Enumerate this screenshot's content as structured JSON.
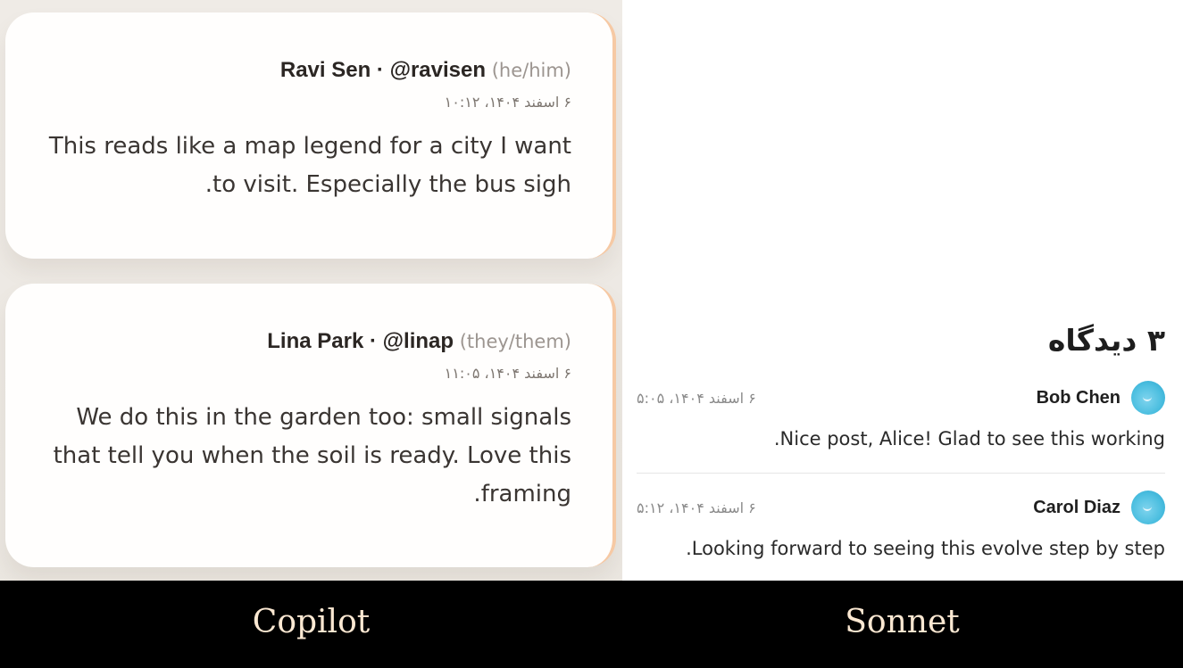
{
  "copilot_panel": {
    "posts": [
      {
        "display": "Ravi Sen · @ravisen",
        "pronouns": "(he/him)",
        "timestamp": "۶ اسفند ۱۴۰۴، ۱۰:۱۲",
        "body": "This reads like a map legend for a city I want to visit. Especially the bus sigh."
      },
      {
        "display": "Lina Park · @linap",
        "pronouns": "(they/them)",
        "timestamp": "۶ اسفند ۱۴۰۴، ۱۱:۰۵",
        "body": "We do this in the garden too: small signals that tell you when the soil is ready. Love this framing."
      }
    ]
  },
  "sonnet_panel": {
    "comments_title": "۳ دیدگاه",
    "comments": [
      {
        "name": "Bob Chen",
        "timestamp": "۶ اسفند ۱۴۰۴، ۵:۰۵",
        "text": "Nice post, Alice! Glad to see this working."
      },
      {
        "name": "Carol Diaz",
        "timestamp": "۶ اسفند ۱۴۰۴، ۵:۱۲",
        "text": "Looking forward to seeing this evolve step by step."
      }
    ]
  },
  "labels": {
    "left": "Copilot",
    "right": "Sonnet"
  },
  "colors": {
    "card_accent": "#f6c9a4",
    "avatar": "#4dbfe0",
    "label_text": "#fbe8d2"
  }
}
